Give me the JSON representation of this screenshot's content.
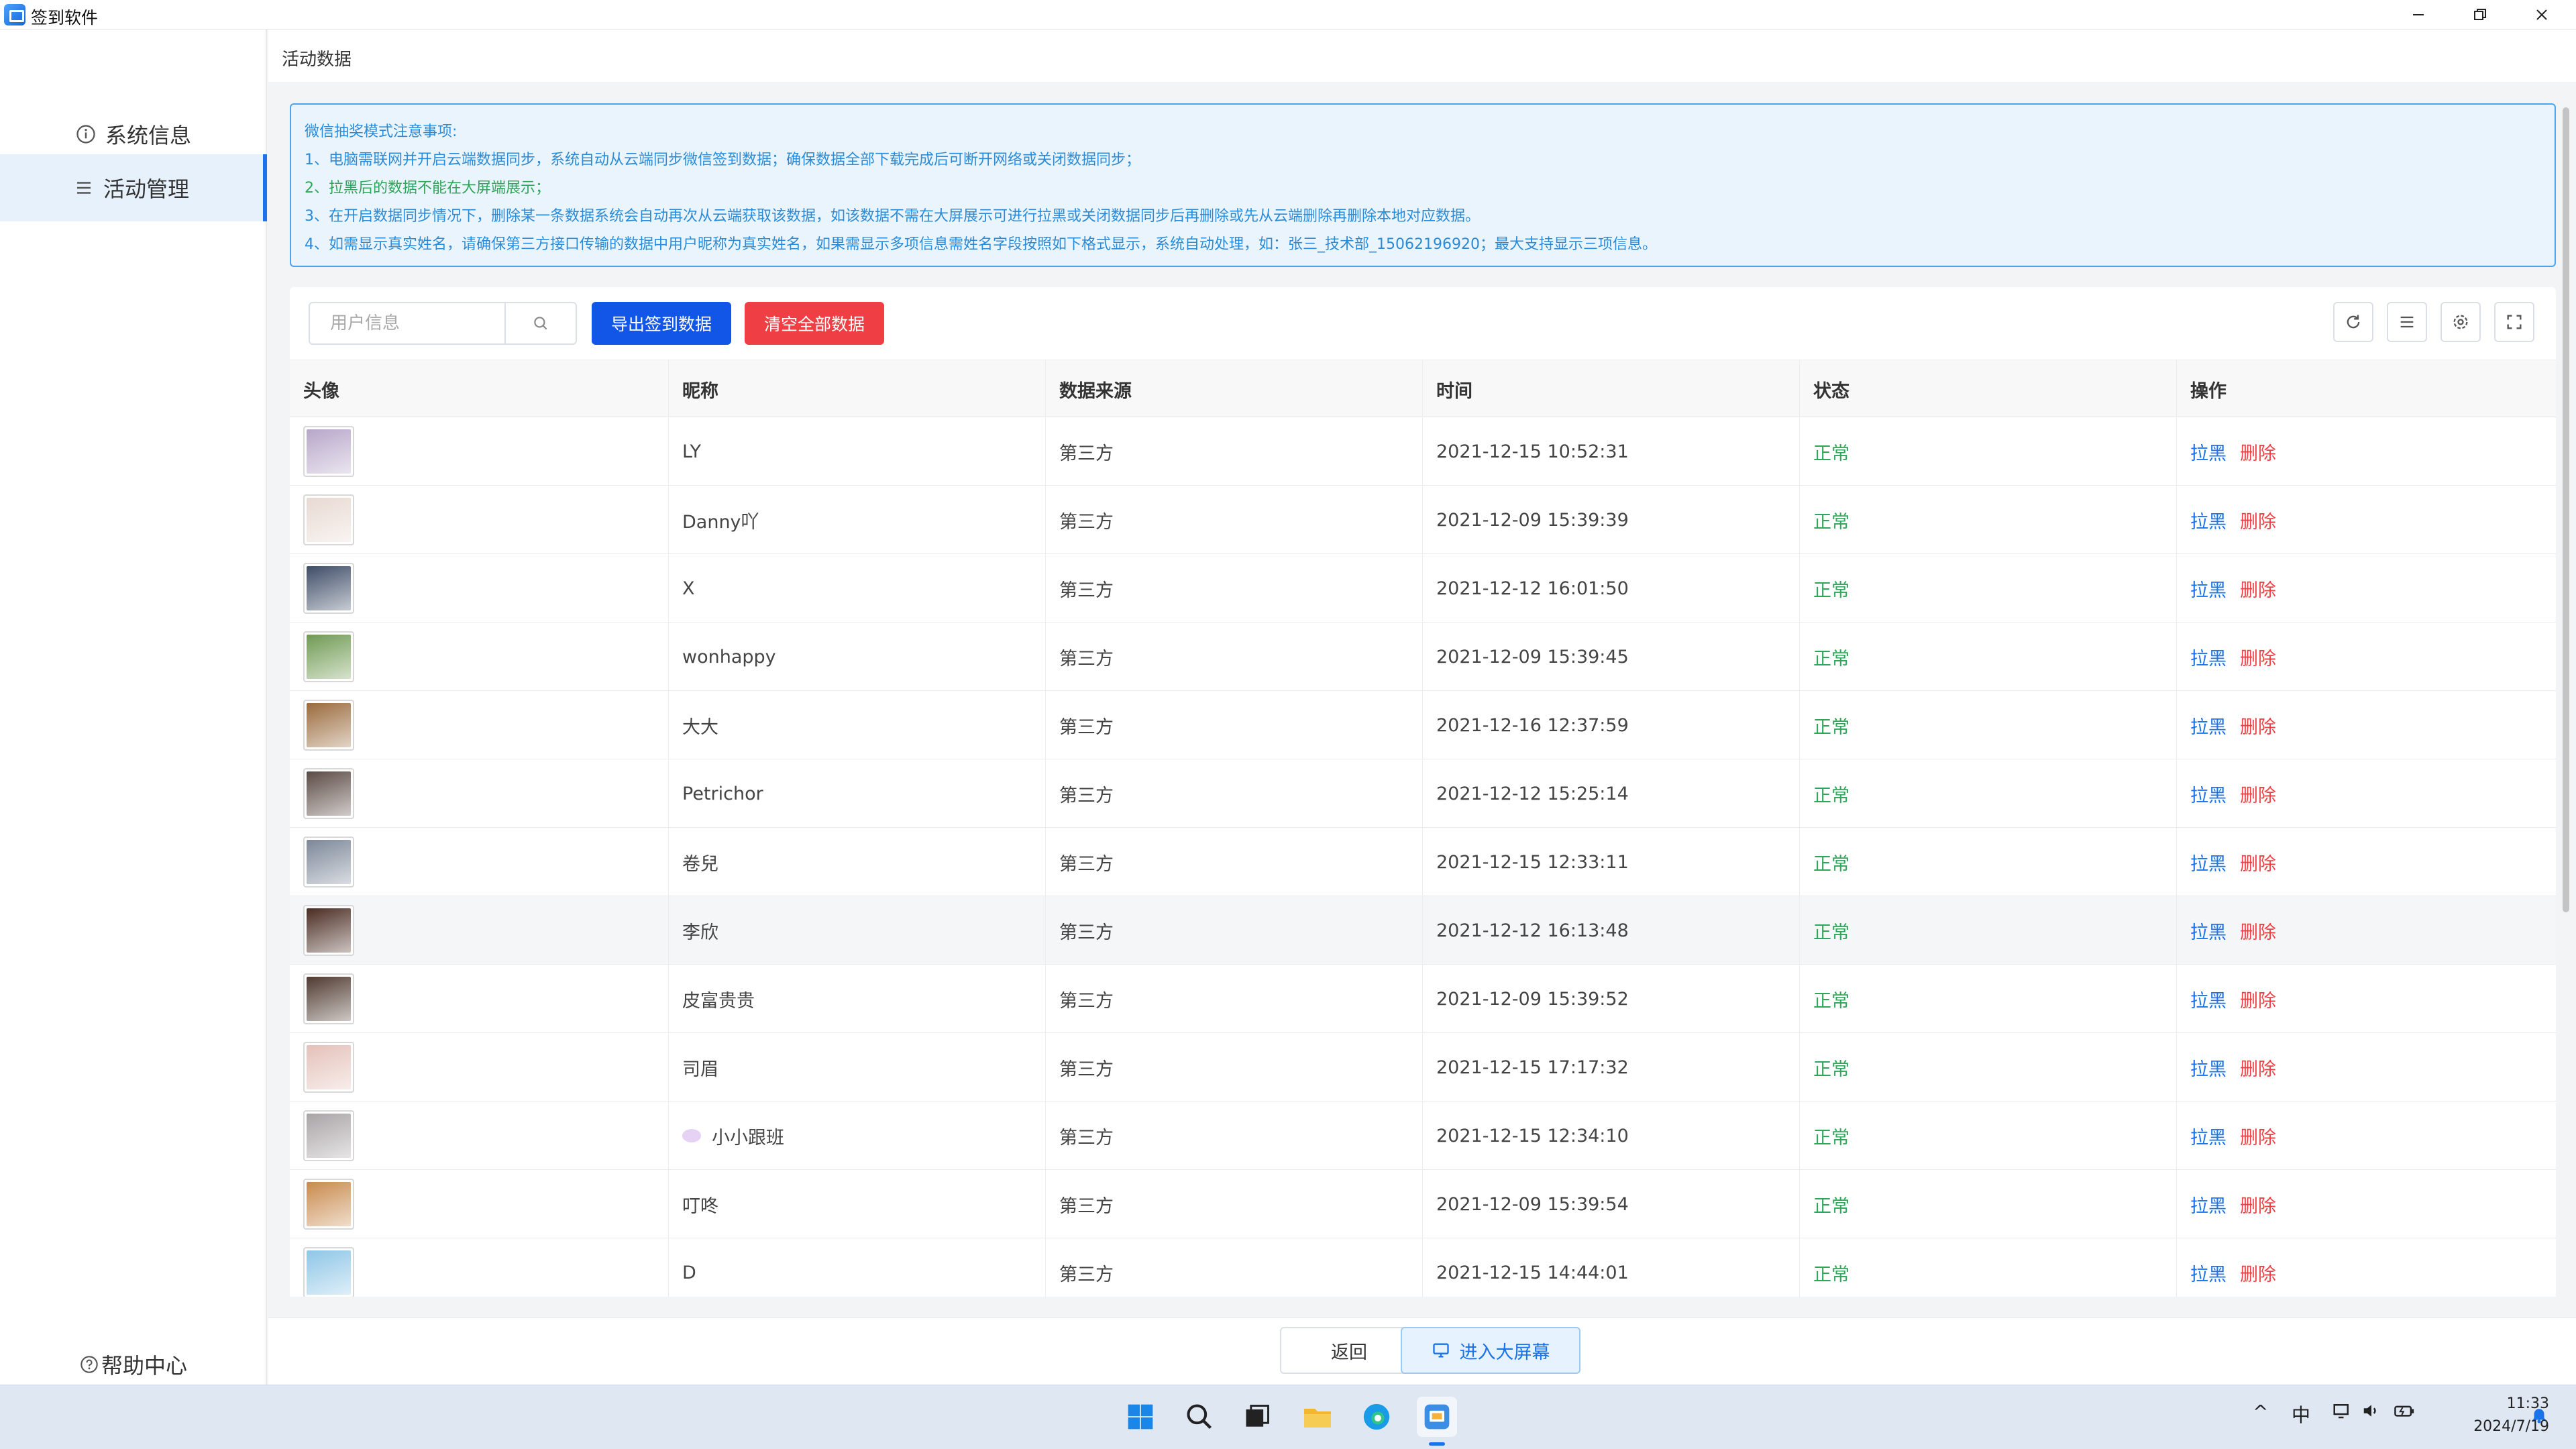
{
  "window": {
    "title": "签到软件",
    "min_icon": "minimize-icon",
    "max_icon": "restore-icon",
    "close_icon": "close-icon"
  },
  "sidebar": {
    "items": [
      {
        "label": "系统信息",
        "icon": "info-icon"
      },
      {
        "label": "活动管理",
        "icon": "menu-icon"
      }
    ],
    "help": "帮助中心"
  },
  "breadcrumb": "活动数据",
  "notice": {
    "title": "微信抽奖模式注意事项:",
    "lines": [
      "1、电脑需联网并开启云端数据同步，系统自动从云端同步微信签到数据；确保数据全部下载完成后可断开网络或关闭数据同步；",
      "2、拉黑后的数据不能在大屏端展示；",
      "3、在开启数据同步情况下，删除某一条数据系统会自动再次从云端获取该数据，如该数据不需在大屏展示可进行拉黑或关闭数据同步后再删除或先从云端删除再删除本地对应数据。",
      "4、如需显示真实姓名，请确保第三方接口传输的数据中用户昵称为真实姓名，如果需显示多项信息需姓名字段按照如下格式显示，系统自动处理，如：张三_技术部_15062196920；最大支持显示三项信息。"
    ]
  },
  "toolbar": {
    "search_placeholder": "用户信息",
    "export_label": "导出签到数据",
    "clear_label": "清空全部数据"
  },
  "table": {
    "columns": [
      "头像",
      "昵称",
      "数据来源",
      "时间",
      "状态",
      "操作"
    ],
    "rows": [
      {
        "nickname": "LY",
        "source": "第三方",
        "time": "2021-12-15 10:52:31",
        "status": "正常",
        "avatar_color": "#b7a6c9"
      },
      {
        "nickname": "Danny吖",
        "source": "第三方",
        "time": "2021-12-09 15:39:39",
        "status": "正常",
        "avatar_color": "#e8d9d2"
      },
      {
        "nickname": "X",
        "source": "第三方",
        "time": "2021-12-12 16:01:50",
        "status": "正常",
        "avatar_color": "#3d4c66"
      },
      {
        "nickname": "wonhappy",
        "source": "第三方",
        "time": "2021-12-09 15:39:45",
        "status": "正常",
        "avatar_color": "#6f9a52"
      },
      {
        "nickname": "大大",
        "source": "第三方",
        "time": "2021-12-16 12:37:59",
        "status": "正常",
        "avatar_color": "#9a6a3c"
      },
      {
        "nickname": "Petrichor",
        "source": "第三方",
        "time": "2021-12-12 15:25:14",
        "status": "正常",
        "avatar_color": "#5b4a44"
      },
      {
        "nickname": "卷兒",
        "source": "第三方",
        "time": "2021-12-15 12:33:11",
        "status": "正常",
        "avatar_color": "#7c8798"
      },
      {
        "nickname": "李欣",
        "source": "第三方",
        "time": "2021-12-12 16:13:48",
        "status": "正常",
        "avatar_color": "#4a2c22"
      },
      {
        "nickname": "皮富贵贵",
        "source": "第三方",
        "time": "2021-12-09 15:39:52",
        "status": "正常",
        "avatar_color": "#4f3a30"
      },
      {
        "nickname": "司眉",
        "source": "第三方",
        "time": "2021-12-15 17:17:32",
        "status": "正常",
        "avatar_color": "#e4c1b9"
      },
      {
        "nickname": "小小跟班",
        "source": "第三方",
        "time": "2021-12-15 12:34:10",
        "status": "正常",
        "avatar_color": "#a9a3a6"
      },
      {
        "nickname": "叮咚",
        "source": "第三方",
        "time": "2021-12-09 15:39:54",
        "status": "正常",
        "avatar_color": "#c98a4d"
      },
      {
        "nickname": "D",
        "source": "第三方",
        "time": "2021-12-15 14:44:01",
        "status": "正常",
        "avatar_color": "#8ec6e6"
      }
    ],
    "action_block": "拉黑",
    "action_delete": "删除"
  },
  "footer": {
    "back_label": "返回",
    "bigscreen_label": "进入大屏幕"
  },
  "taskbar": {
    "ime": "中",
    "time": "11:33",
    "date": "2024/7/19"
  },
  "colors": {
    "primary": "#1256e8",
    "danger": "#ef3f44",
    "success": "#2ea65a",
    "notice_text": "#2a8bd8"
  }
}
